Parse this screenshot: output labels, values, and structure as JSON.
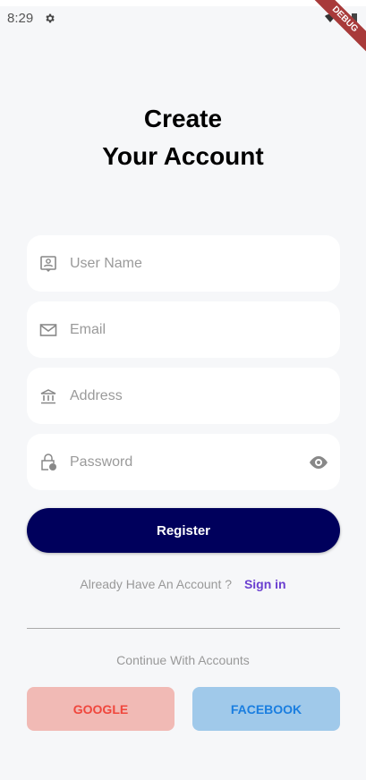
{
  "status": {
    "time": "8:29",
    "debug_banner": "DEBUG"
  },
  "title": {
    "line1": "Create",
    "line2": "Your Account"
  },
  "fields": [
    {
      "placeholder": "User Name",
      "icon": "contact-icon"
    },
    {
      "placeholder": "Email",
      "icon": "mail-icon"
    },
    {
      "placeholder": "Address",
      "icon": "bank-icon"
    },
    {
      "placeholder": "Password",
      "icon": "lock-clock-icon"
    }
  ],
  "register_label": "Register",
  "signin": {
    "prompt": "Already Have An Account ?",
    "link": "Sign in"
  },
  "continue_text": "Continue With Accounts",
  "social": {
    "google": "GOOGLE",
    "facebook": "FACEBOOK"
  }
}
